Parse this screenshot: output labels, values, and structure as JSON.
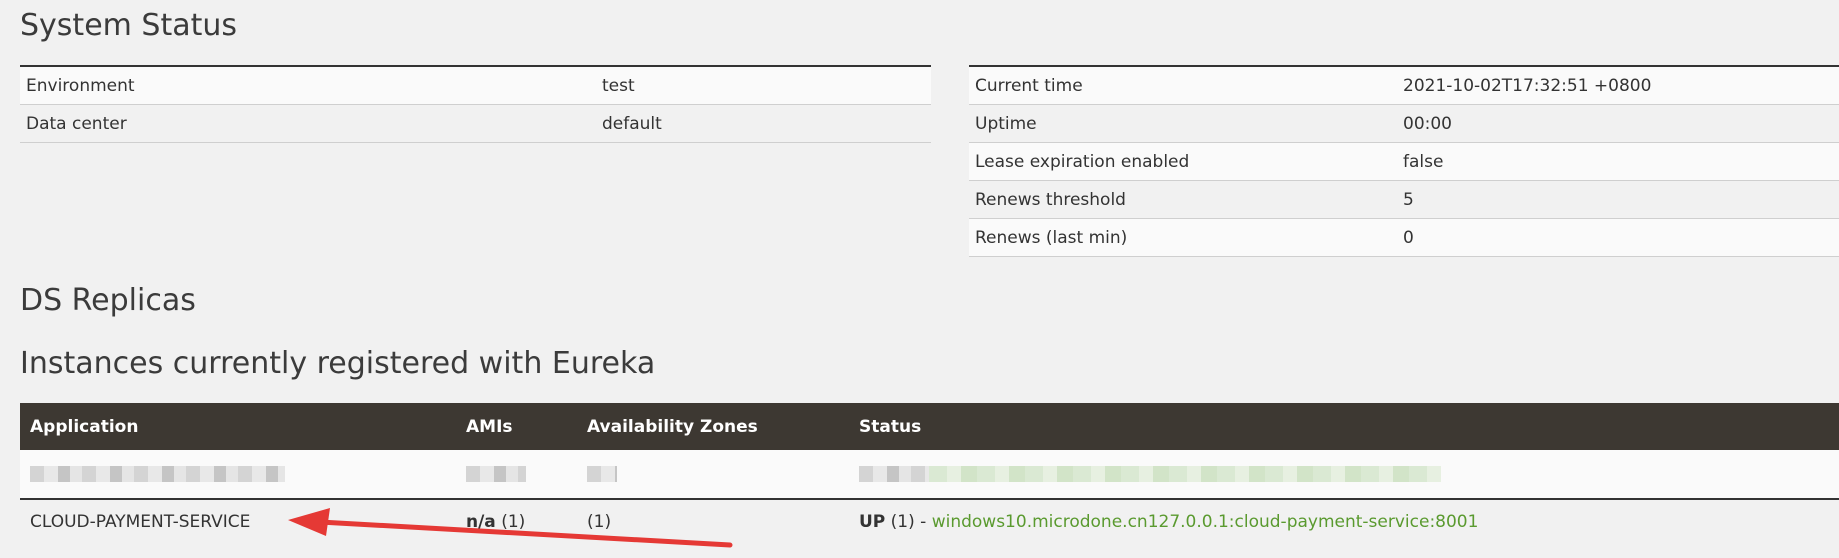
{
  "titles": {
    "system_status": "System Status",
    "ds_replicas": "DS Replicas",
    "instances": "Instances currently registered with Eureka"
  },
  "environment": {
    "rows": [
      {
        "key": "Environment",
        "value": "test"
      },
      {
        "key": "Data center",
        "value": "default"
      }
    ]
  },
  "time_info": {
    "rows": [
      {
        "key": "Current time",
        "value": "2021-10-02T17:32:51 +0800"
      },
      {
        "key": "Uptime",
        "value": "00:00"
      },
      {
        "key": "Lease expiration enabled",
        "value": "false"
      },
      {
        "key": "Renews threshold",
        "value": "5"
      },
      {
        "key": "Renews (last min)",
        "value": "0"
      }
    ]
  },
  "instances": {
    "headers": [
      "Application",
      "AMIs",
      "Availability Zones",
      "Status"
    ],
    "main_row": {
      "application": "CLOUD-PAYMENT-SERVICE",
      "amis_bold": "n/a",
      "amis_count": " (1)",
      "zones": "(1)",
      "status_bold": "UP",
      "status_count": " (1) - ",
      "link": "windows10.microdone.cn127.0.0.1:cloud-payment-service:8001"
    }
  },
  "colors": {
    "header_bg": "#3d3832",
    "link_green": "#5a9a2f",
    "arrow_red": "#e53935"
  }
}
